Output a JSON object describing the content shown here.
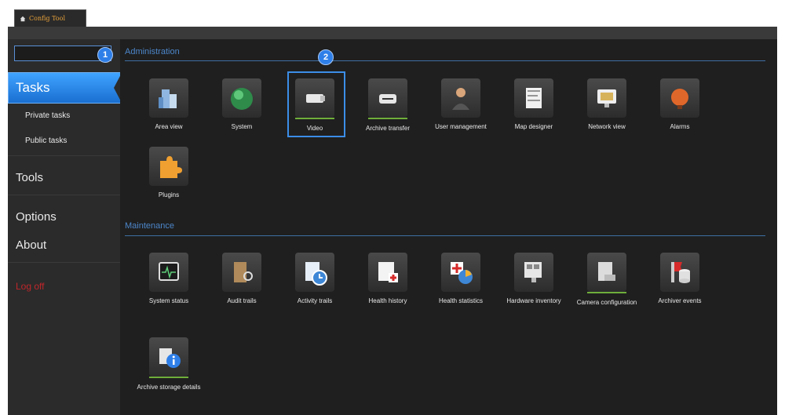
{
  "app_tab": {
    "title": "Config Tool",
    "icon": "home-icon"
  },
  "badges": {
    "one": "1",
    "two": "2"
  },
  "sidebar": {
    "search_placeholder": "",
    "tasks": "Tasks",
    "private_tasks": "Private tasks",
    "public_tasks": "Public tasks",
    "tools": "Tools",
    "options": "Options",
    "about": "About",
    "logoff": "Log off"
  },
  "sections": {
    "administration": {
      "title": "Administration",
      "tiles": [
        {
          "label": "Area view",
          "icon": "area-view-icon"
        },
        {
          "label": "System",
          "icon": "system-icon"
        },
        {
          "label": "Video",
          "icon": "video-camera-icon"
        },
        {
          "label": "Archive transfer",
          "icon": "archive-transfer-icon"
        },
        {
          "label": "User management",
          "icon": "user-management-icon"
        },
        {
          "label": "Map designer",
          "icon": "map-designer-icon"
        },
        {
          "label": "Network view",
          "icon": "network-view-icon"
        },
        {
          "label": "Alarms",
          "icon": "alarm-icon"
        },
        {
          "label": "Plugins",
          "icon": "plugin-icon"
        }
      ]
    },
    "maintenance": {
      "title": "Maintenance",
      "tiles": [
        {
          "label": "System status",
          "icon": "system-status-icon"
        },
        {
          "label": "Audit trails",
          "icon": "audit-trails-icon"
        },
        {
          "label": "Activity trails",
          "icon": "activity-trails-icon"
        },
        {
          "label": "Health history",
          "icon": "health-history-icon"
        },
        {
          "label": "Health statistics",
          "icon": "health-statistics-icon"
        },
        {
          "label": "Hardware inventory",
          "icon": "hardware-inventory-icon"
        },
        {
          "label": "Camera configuration",
          "icon": "camera-configuration-icon"
        },
        {
          "label": "Archiver events",
          "icon": "archiver-events-icon"
        },
        {
          "label": "Archive storage details",
          "icon": "archive-storage-details-icon"
        }
      ]
    }
  },
  "colors": {
    "accent": "#2f7fe8",
    "section_title": "#4c86c9",
    "logoff": "#c0262b",
    "tile_underline": "#6fae3a"
  }
}
